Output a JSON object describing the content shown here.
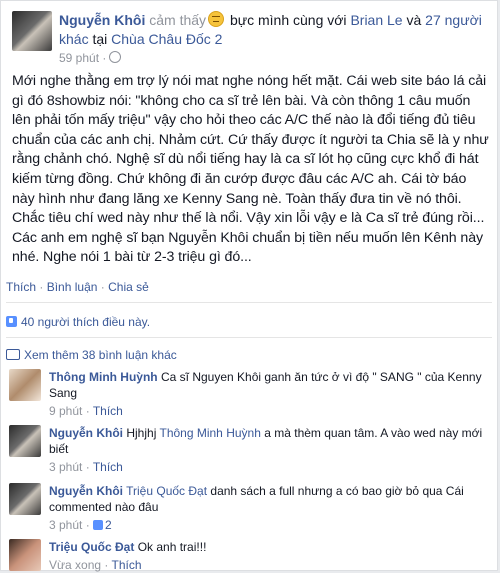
{
  "header": {
    "name": "Nguyễn Khôi",
    "feeling_prefix": "cảm thấy",
    "feeling_icon": "frustrated-emoji-icon",
    "feeling": "bực mình cùng với",
    "tagged": "Brian Le",
    "and": "và",
    "others": "27 người khác",
    "at": "tại",
    "place": "Chùa Châu Đốc 2",
    "time": "59 phút",
    "privacy_icon": "globe-icon"
  },
  "post": {
    "text": "Mới nghe thằng em trợ lý nói mat nghe nóng hết mặt. Cái web site báo lá cải gì đó 8showbiz nói: \"không cho ca sĩ trẻ lên bài. Và còn thông 1 câu muốn lên phải tốn mấy triệu\" vậy cho hỏi theo các A/C thế nào là đổi tiếng đủ tiêu chuẩn của các anh chị. Nhảm cứt. Cứ thấy được ít người ta Chia sẽ là y như rằng chảnh chó. Nghệ sĩ dù nổi tiếng hay là ca sĩ lót họ cũng cực khổ đi hát kiếm từng đồng. Chứ không đi ăn cướp được đâu các A/C ah. Cái tờ báo này hình như đang lăng xe Kenny Sang nè. Toàn thấy đưa tin về nó thôi. Chắc tiêu chí wed này như thế là nổi. Vậy xin lỗi vậy e là Ca sĩ trẻ đúng rồi... Các anh em nghệ sĩ bạn Nguyễn Khôi chuẩn bị tiền nếu muốn lên Kênh này nhé. Nghe nói 1 bài từ 2-3 triệu gì đó..."
  },
  "actions": {
    "like": "Thích",
    "comment": "Bình luận",
    "share": "Chia sẻ",
    "sep": "·"
  },
  "likes": {
    "icon": "like-thumb-icon",
    "text": "40 người thích điều này."
  },
  "view_more": {
    "icon": "comment-bubble-icon",
    "text": "Xem thêm 38 bình luận khác"
  },
  "comments": [
    {
      "author": "Thông Minh Huỳnh",
      "text": "Ca sĩ Nguyen Khôi ganh ăn tức ở vì độ \" SANG \" của Kenny Sang",
      "time": "9 phút",
      "like": "Thích"
    },
    {
      "author": "Nguyễn Khôi",
      "mention": "Thông Minh Huỳnh",
      "pre": "Hjhjhj",
      "text": "a mà thèm quan tâm. A vào wed này mới biết",
      "time": "3 phút",
      "like": "Thích"
    },
    {
      "author": "Nguyễn Khôi",
      "mention": "Triệu Quốc Đạt",
      "text": "danh sách a full nhưng a có bao giờ bỏ qua Cái commented nào đâu",
      "time": "3 phút",
      "like_count": "2"
    },
    {
      "author": "Triệu Quốc Đạt",
      "text": "Ok anh trai!!!",
      "time": "Vừa xong",
      "like": "Thích"
    }
  ]
}
